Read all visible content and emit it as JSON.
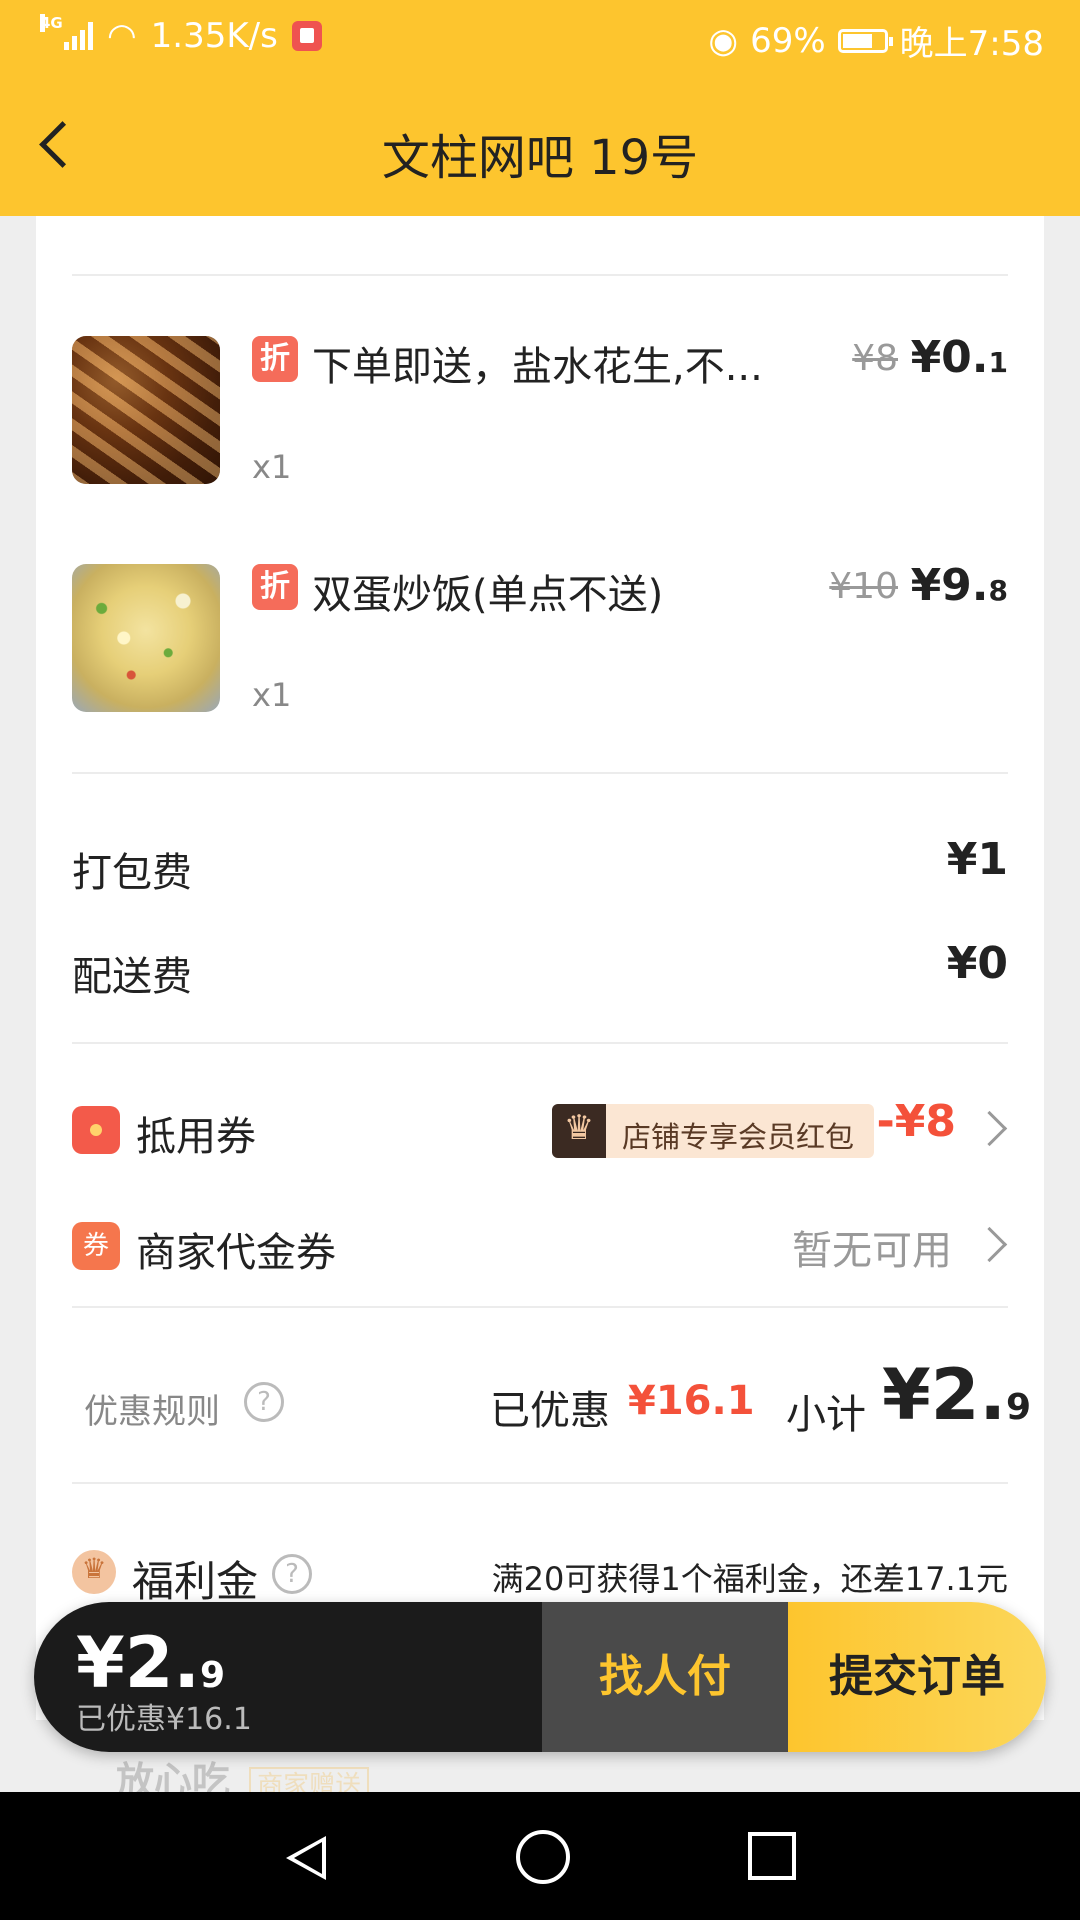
{
  "status_bar": {
    "network_type": "4G",
    "speed": "1.35K/s",
    "battery": "69%",
    "time": "晚上7:58"
  },
  "header": {
    "title": "文柱网吧 19号"
  },
  "items": [
    {
      "name": "下单即送，盐水花生,不...",
      "tag": "折",
      "qty": "x1",
      "price_old": "¥8",
      "price_int": "¥0.",
      "price_dec": "1"
    },
    {
      "name": "双蛋炒饭(单点不送)",
      "tag": "折",
      "qty": "x1",
      "price_old": "¥10",
      "price_int": "¥9.",
      "price_dec": "8"
    }
  ],
  "fees": {
    "packing_label": "打包费",
    "packing_value": "¥1",
    "delivery_label": "配送费",
    "delivery_value": "¥0"
  },
  "coupons": {
    "voucher_label": "抵用券",
    "member_badge_text": "店铺专享会员红包",
    "voucher_discount": "-¥8",
    "merchant_label": "商家代金券",
    "merchant_icon_text": "券",
    "merchant_value": "暂无可用"
  },
  "summary": {
    "rules_label": "优惠规则",
    "help": "?",
    "saved_label": "已优惠",
    "saved_value": "¥16.1",
    "subtotal_label": "小计",
    "subtotal_int": "¥2.",
    "subtotal_dec": "9"
  },
  "welfare": {
    "label": "福利金",
    "note": "满20可获得1个福利金，还差17.1元"
  },
  "faded_row": {
    "label": "放心吃",
    "tag": "商家赠送"
  },
  "bottom_bar": {
    "total_int": "¥2.",
    "total_dec": "9",
    "saved": "已优惠¥16.1",
    "pay_for_me": "找人付",
    "submit": "提交订单"
  }
}
